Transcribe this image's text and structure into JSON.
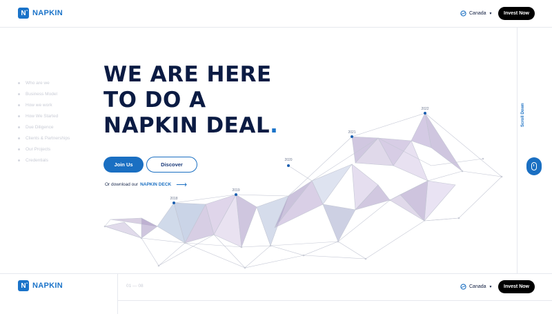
{
  "header": {
    "logo_mark": "N",
    "logo_text": "NAPKIN",
    "region": "Canada",
    "invest_label": "Invest Now"
  },
  "side_nav": [
    "Who are we",
    "Business Model",
    "How we work",
    "How We Started",
    "Due Diligence",
    "Clients & Partnerships",
    "Our Projects",
    "Credentials"
  ],
  "hero": {
    "line1": "WE ARE HERE",
    "line2": "TO DO A",
    "line3": "NAPKIN DEAL",
    "line3_dot": ".",
    "join_label": "Join Us",
    "discover_label": "Discover",
    "download_prefix": "Or download our",
    "download_link": "NAPKIN DECK"
  },
  "chart_labels": [
    "2018",
    "2019",
    "2020",
    "2021",
    "2022"
  ],
  "scroll_label": "Scroll Down",
  "footer": {
    "logo_mark": "N",
    "logo_text": "NAPKIN",
    "counter": "01 — 08",
    "region": "Canada",
    "invest_label": "Invest Now"
  },
  "colors": {
    "accent": "#1a73c9",
    "navy": "#0b1b43",
    "button_black": "#000000"
  }
}
